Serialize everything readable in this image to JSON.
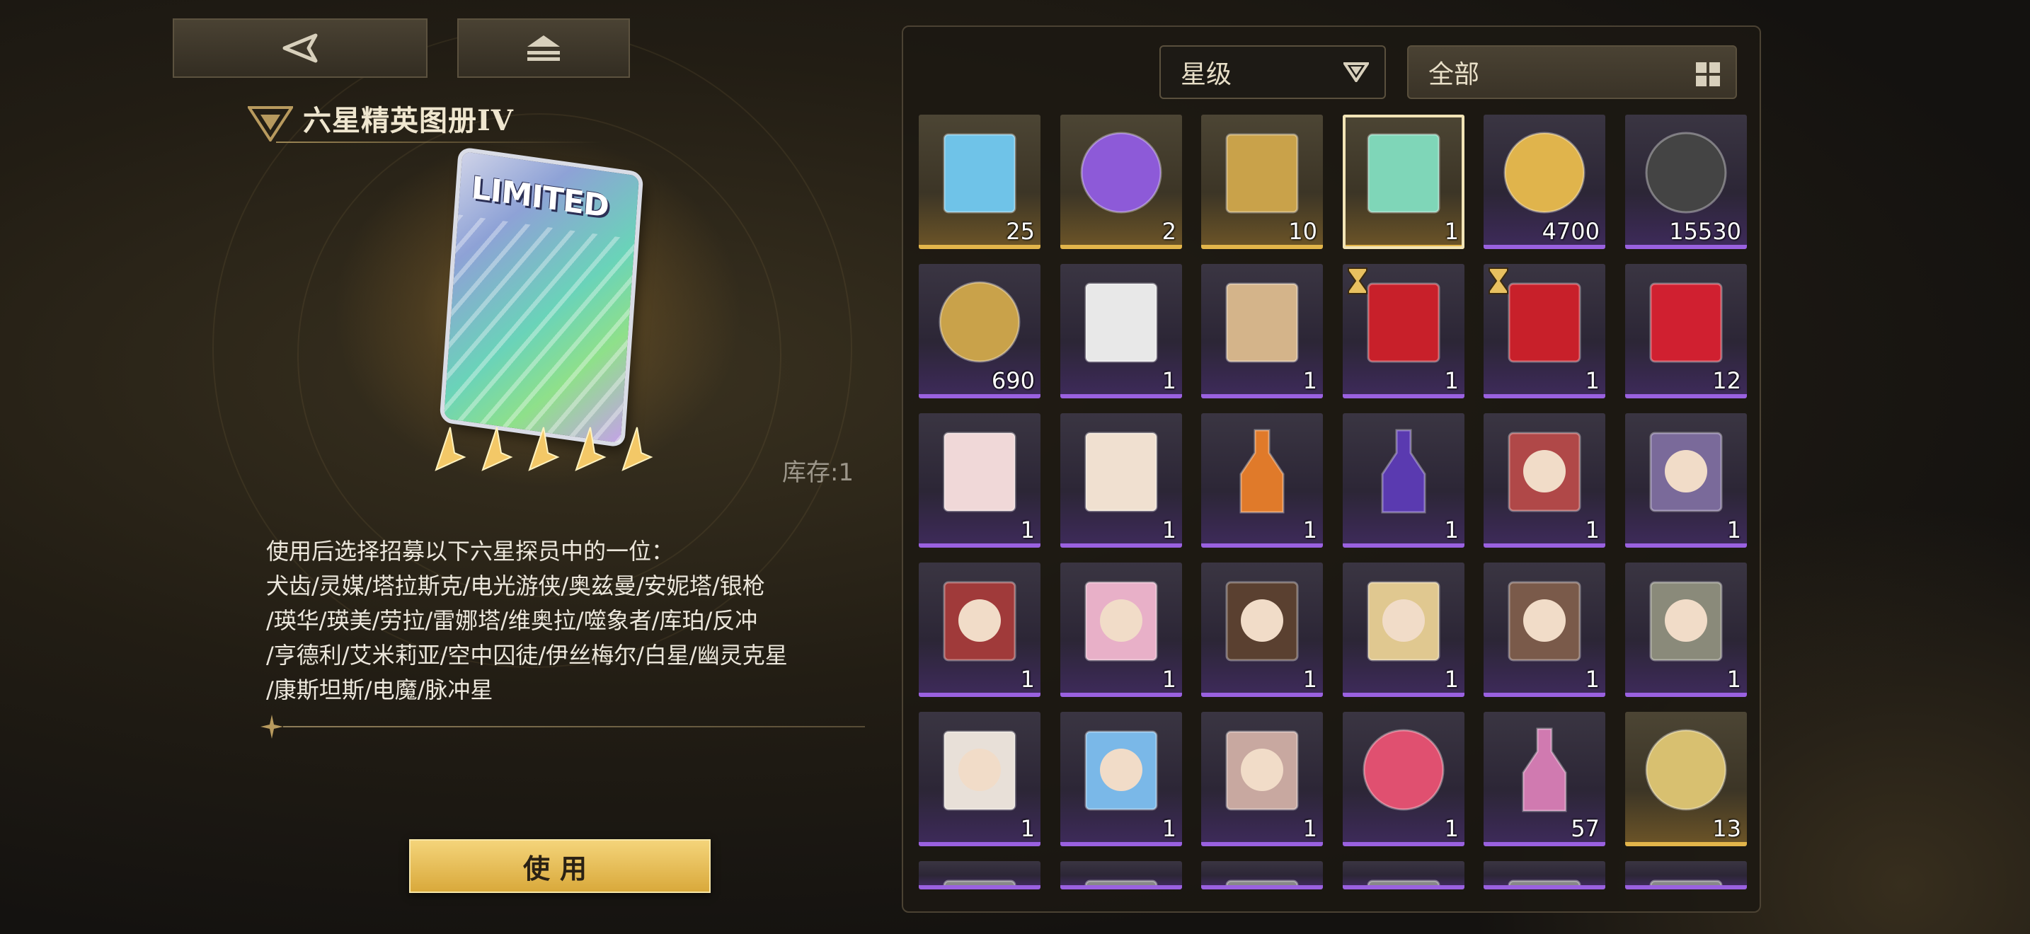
{
  "colors": {
    "accent_gold": "#e3b54a",
    "rarity_purple": "#9a61e0",
    "text_light": "#ece7dc",
    "use_button": "#e8bd55"
  },
  "nav": {
    "back_icon": "back-arrow-icon",
    "collapse_icon": "eject-icon"
  },
  "item": {
    "title": "六星精英图册IV",
    "card_label": "LIMITED",
    "stars": 5,
    "stock": "库存:1",
    "description": "使用后选择招募以下六星探员中的一位：\n犬齿/灵媒/塔拉斯克/电光游侠/奥兹曼/安妮塔/银枪\n/瑛华/瑛美/劳拉/雷娜塔/维奥拉/噬象者/库珀/反冲\n/亨德利/艾米莉亚/空中囚徒/伊丝梅尔/白星/幽灵克星\n/康斯坦斯/电魔/脉冲星",
    "use_label": "使用"
  },
  "filters": {
    "rarity": {
      "label": "星级",
      "icon": "dropdown-triangle-icon"
    },
    "category": {
      "label": "全部",
      "icon": "grid-icon"
    }
  },
  "inventory": [
    {
      "name": "p-card",
      "count": "25",
      "rarity": "gold"
    },
    {
      "name": "audio-orb",
      "count": "2",
      "rarity": "gold"
    },
    {
      "name": "film-crosshair",
      "count": "10",
      "rarity": "gold"
    },
    {
      "name": "limited-album",
      "count": "1",
      "rarity": "gold",
      "selected": true
    },
    {
      "name": "gold-orb",
      "count": "4700",
      "rarity": "purple"
    },
    {
      "name": "bcr-record",
      "count": "15530",
      "rarity": "purple"
    },
    {
      "name": "badge-coin",
      "count": "690",
      "rarity": "purple"
    },
    {
      "name": "letter-pen",
      "count": "1",
      "rarity": "purple"
    },
    {
      "name": "clipboard",
      "count": "1",
      "rarity": "purple"
    },
    {
      "name": "red-box",
      "count": "1",
      "rarity": "purple",
      "timed": true
    },
    {
      "name": "red-box",
      "count": "1",
      "rarity": "purple",
      "timed": true
    },
    {
      "name": "moggy-gift",
      "count": "12",
      "rarity": "purple"
    },
    {
      "name": "noodle-card",
      "count": "1",
      "rarity": "purple"
    },
    {
      "name": "bento-card",
      "count": "1",
      "rarity": "purple"
    },
    {
      "name": "orange-bottle",
      "count": "1",
      "rarity": "purple"
    },
    {
      "name": "purple-bottle",
      "count": "1",
      "rarity": "purple"
    },
    {
      "name": "portrait-red-hair",
      "count": "1",
      "rarity": "purple"
    },
    {
      "name": "portrait-robot",
      "count": "1",
      "rarity": "purple"
    },
    {
      "name": "portrait-red-cap",
      "count": "1",
      "rarity": "purple"
    },
    {
      "name": "portrait-pink-hair",
      "count": "1",
      "rarity": "purple"
    },
    {
      "name": "portrait-dark-hair",
      "count": "1",
      "rarity": "purple"
    },
    {
      "name": "portrait-blonde",
      "count": "1",
      "rarity": "purple"
    },
    {
      "name": "portrait-headphones",
      "count": "1",
      "rarity": "purple"
    },
    {
      "name": "portrait-wolf",
      "count": "1",
      "rarity": "purple"
    },
    {
      "name": "portrait-white-hair",
      "count": "1",
      "rarity": "purple"
    },
    {
      "name": "portrait-blue-hair",
      "count": "1",
      "rarity": "purple"
    },
    {
      "name": "portrait-grey-hair",
      "count": "1",
      "rarity": "purple"
    },
    {
      "name": "pink-crystal",
      "count": "1",
      "rarity": "purple"
    },
    {
      "name": "rainbow-potion",
      "count": "57",
      "rarity": "purple"
    },
    {
      "name": "bcr-gold-disc",
      "count": "13",
      "rarity": "gold"
    },
    {
      "name": "partial-1",
      "count": "",
      "rarity": "purple"
    },
    {
      "name": "partial-2",
      "count": "",
      "rarity": "purple"
    },
    {
      "name": "partial-3",
      "count": "",
      "rarity": "purple"
    },
    {
      "name": "partial-4",
      "count": "",
      "rarity": "purple"
    },
    {
      "name": "partial-5",
      "count": "",
      "rarity": "purple"
    },
    {
      "name": "partial-6",
      "count": "",
      "rarity": "purple"
    }
  ]
}
